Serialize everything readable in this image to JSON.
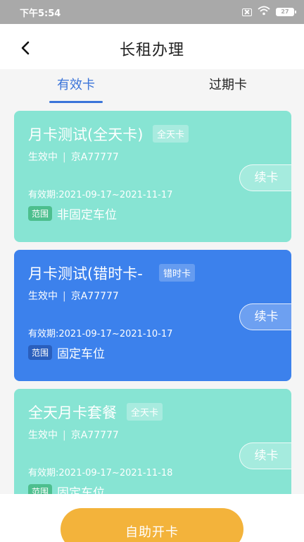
{
  "status_bar": {
    "time": "下午5:54",
    "battery": "27"
  },
  "header": {
    "title": "长租办理"
  },
  "tabs": [
    {
      "label": "有效卡",
      "active": true
    },
    {
      "label": "过期卡",
      "active": false
    }
  ],
  "cards": [
    {
      "name": "月卡测试(全天卡)",
      "type_tag": "全天卡",
      "status": "生效中",
      "plate": "京A77777",
      "validity": "有效期:2021-09-17~2021-11-17",
      "scope_badge": "范围",
      "scope": "非固定车位",
      "renew_label": "续卡",
      "color": "#87e4d3"
    },
    {
      "name": "月卡测试(错时卡-",
      "type_tag": "错时卡",
      "status": "生效中",
      "plate": "京A77777",
      "validity": "有效期:2021-09-17~2021-10-17",
      "scope_badge": "范围",
      "scope": "固定车位",
      "renew_label": "续卡",
      "color": "#3c81ec"
    },
    {
      "name": "全天月卡套餐",
      "type_tag": "全天卡",
      "status": "生效中",
      "plate": "京A77777",
      "validity": "有效期:2021-09-17~2021-11-18",
      "scope_badge": "范围",
      "scope": "固定车位",
      "renew_label": "续卡",
      "color": "#87e4d3"
    }
  ],
  "bottom": {
    "button_label": "自助开卡"
  },
  "colors": {
    "accent": "#3a74d9",
    "button": "#f3b33b"
  },
  "icons": {
    "back": "chevron-left-icon",
    "wifi": "wifi-icon",
    "sim": "sim-off-icon",
    "battery": "battery-icon"
  }
}
